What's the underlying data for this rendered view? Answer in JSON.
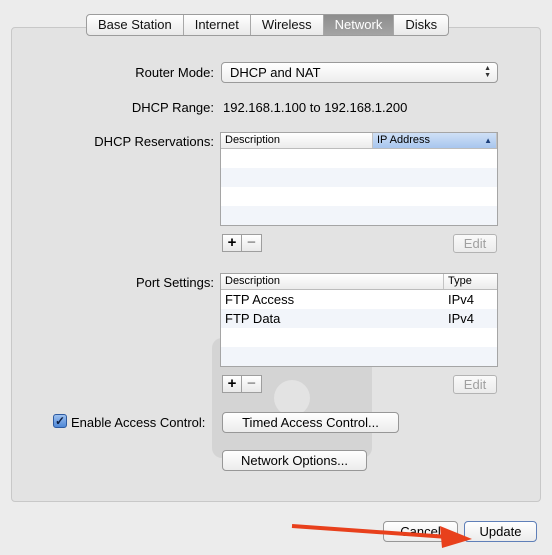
{
  "tabs": [
    "Base Station",
    "Internet",
    "Wireless",
    "Network",
    "Disks"
  ],
  "active_tab": "Network",
  "router_mode": {
    "label": "Router Mode:",
    "value": "DHCP and NAT"
  },
  "dhcp_range": {
    "label": "DHCP Range:",
    "value": "192.168.1.100 to 192.168.1.200"
  },
  "dhcp_reservations": {
    "label": "DHCP Reservations:",
    "columns": [
      "Description",
      "IP Address"
    ],
    "rows": [],
    "add_label": "+",
    "remove_label": "−",
    "edit_label": "Edit"
  },
  "port_settings": {
    "label": "Port Settings:",
    "columns": [
      "Description",
      "Type"
    ],
    "rows": [
      {
        "description": "FTP Access",
        "type": "IPv4"
      },
      {
        "description": "FTP Data",
        "type": "IPv4"
      }
    ],
    "add_label": "+",
    "remove_label": "−",
    "edit_label": "Edit"
  },
  "access_control": {
    "checkbox_label": "Enable Access Control:",
    "checked": true,
    "timed_button": "Timed Access Control..."
  },
  "network_options_button": "Network Options...",
  "footer": {
    "cancel_label": "Cancel",
    "update_label": "Update"
  },
  "colors": {
    "arrow": "#e8401c",
    "selected_header": "#a8c6ee",
    "active_tab": "#8d8d8d"
  },
  "icons": {
    "checkmark": "checkmark-icon",
    "popup": "updown-arrows-icon",
    "sort": "sort-ascending-icon"
  }
}
